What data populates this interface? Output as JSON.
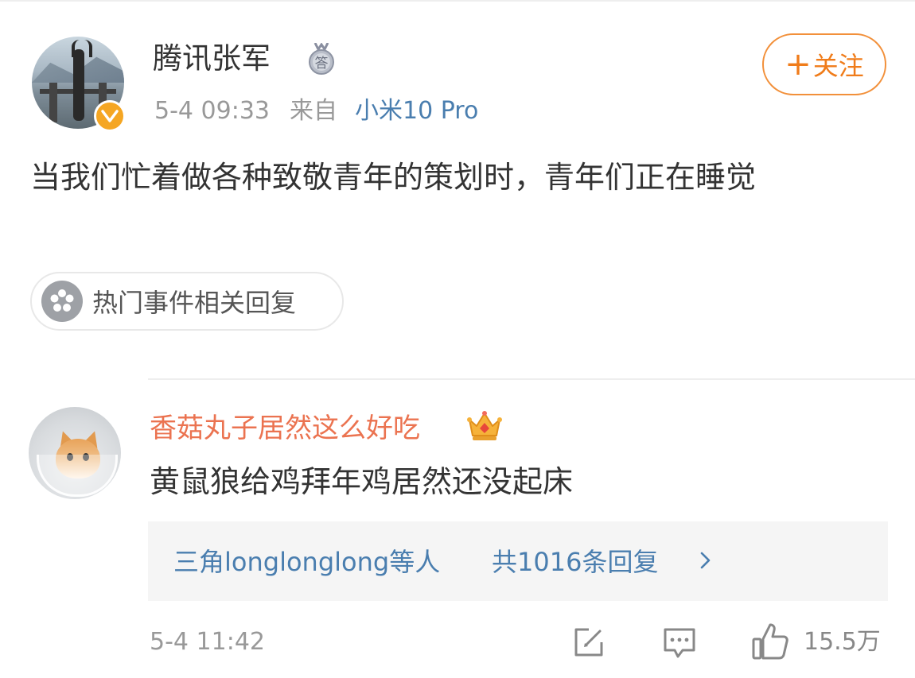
{
  "post": {
    "username": "腾讯张军",
    "medal_char": "答",
    "time": "5-4 09:33",
    "from_label": "来自",
    "device": "小米10 Pro",
    "follow_plus": "+",
    "follow_label": "关注",
    "text": "当我们忙着做各种致敬青年的策划时，青年们正在睡觉",
    "topic_chip": "热门事件相关回复"
  },
  "comment": {
    "username": "香菇丸子居然这么好吃",
    "text": "黄鼠狼给鸡拜年鸡居然还没起床",
    "replies_users": "三角longlonglong等人",
    "replies_count": "共1016条回复",
    "time": "5-4 11:42",
    "likes": "15.5万"
  },
  "colors": {
    "follow_orange": "#f07c1a",
    "link_blue": "#4a7eaf",
    "comment_name_orange": "#eb7350",
    "verified_badge": "#f5a623",
    "muted_gray": "#999999"
  },
  "icons": [
    "verified-v-icon",
    "medal-icon",
    "topic-flower-icon",
    "crown-icon",
    "chevron-right-icon",
    "edit-icon",
    "comment-icon",
    "like-thumb-icon"
  ]
}
